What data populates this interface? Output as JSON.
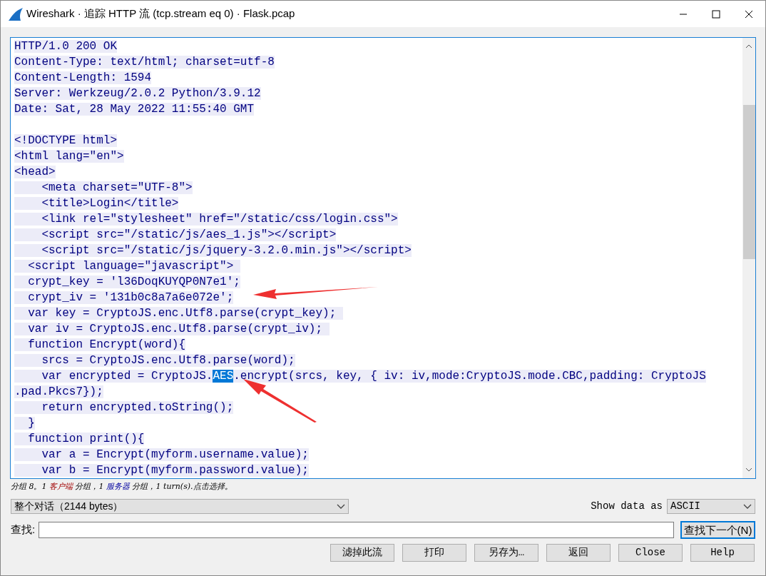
{
  "window": {
    "title": "Wireshark · 追踪 HTTP 流 (tcp.stream eq 0) · Flask.pcap"
  },
  "stream": {
    "headers": [
      {
        "text": "HTTP/1.0 200 OK"
      },
      {
        "text": "Content-Type: text/html; charset=utf-8"
      },
      {
        "text": "Content-Length: 1594"
      },
      {
        "text": "Server: Werkzeug/2.0.2 Python/3.9.12"
      },
      {
        "text": "Date: Sat, 28 May 2022 11:55:40 GMT"
      }
    ],
    "body": [
      {
        "text": "<!DOCTYPE html>"
      },
      {
        "text": "<html lang=\"en\">"
      },
      {
        "text": "<head>"
      },
      {
        "text": "    <meta charset=\"UTF-8\">"
      },
      {
        "text": "    <title>Login</title>"
      },
      {
        "text": "    <link rel=\"stylesheet\" href=\"/static/css/login.css\">"
      },
      {
        "text": "    <script src=\"/static/js/aes_1.js\"></script>"
      },
      {
        "text": "    <script src=\"/static/js/jquery-3.2.0.min.js\"></script>"
      },
      {
        "text": "  <script language=\"javascript\"> "
      },
      {
        "text": "  crypt_key = 'l36DoqKUYQP0N7e1';"
      },
      {
        "text": "  crypt_iv = '131b0c8a7a6e072e';"
      },
      {
        "text": "  var key = CryptoJS.enc.Utf8.parse(crypt_key); "
      },
      {
        "text": "  var iv = CryptoJS.enc.Utf8.parse(crypt_iv); "
      },
      {
        "text": "  function Encrypt(word){"
      },
      {
        "text": "    srcs = CryptoJS.enc.Utf8.parse(word);"
      },
      {
        "text": "    var encrypted = CryptoJS.",
        "selected_text": "AES",
        "after": ".encrypt(srcs, key, { iv: iv,mode:CryptoJS.mode.CBC,padding: CryptoJS"
      },
      {
        "text": ".pad.Pkcs7});"
      },
      {
        "text": "    return encrypted.toString();"
      },
      {
        "text": "  }"
      },
      {
        "text": "  function print(){"
      },
      {
        "text": "    var a = Encrypt(myform.username.value);"
      },
      {
        "text": "    var b = Encrypt(myform.password.value);"
      }
    ]
  },
  "status": [
    {
      "kind": "plain",
      "text": "分组 8。1 "
    },
    {
      "kind": "client",
      "text": "客户端"
    },
    {
      "kind": "plain",
      "text": " 分组，1 "
    },
    {
      "kind": "server",
      "text": "服务器"
    },
    {
      "kind": "plain",
      "text": " 分组，1 turn(s).点击选择。"
    }
  ],
  "conversation_select": {
    "value": "整个对话（2144 bytes）"
  },
  "show_data_label": "Show data as",
  "show_data_select": {
    "value": "ASCII"
  },
  "find": {
    "label": "查找:",
    "button": "查找下一个(N)"
  },
  "buttons": [
    "滤掉此流",
    "打印",
    "另存为…",
    "返回",
    "Close",
    "Help"
  ]
}
